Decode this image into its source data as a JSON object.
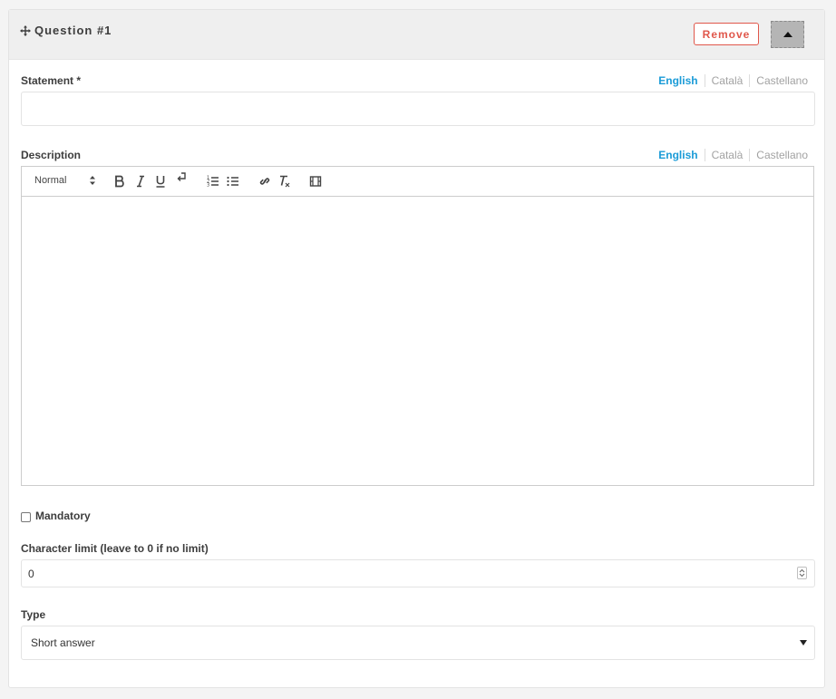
{
  "question": {
    "title": "Question #1",
    "remove_label": "Remove"
  },
  "statement": {
    "label": "Statement *",
    "value": "",
    "languages": [
      "English",
      "Català",
      "Castellano"
    ],
    "active_language": "English"
  },
  "description": {
    "label": "Description",
    "languages": [
      "English",
      "Català",
      "Castellano"
    ],
    "active_language": "English",
    "toolbar": {
      "format_select": "Normal",
      "buttons": [
        "bold-icon",
        "italic-icon",
        "underline-icon",
        "linebreak-icon",
        "ordered-list-icon",
        "bullet-list-icon",
        "link-icon",
        "clear-format-icon",
        "video-icon"
      ]
    },
    "value": ""
  },
  "mandatory": {
    "label": "Mandatory",
    "checked": false
  },
  "character_limit": {
    "label": "Character limit (leave to 0 if no limit)",
    "value": "0"
  },
  "type": {
    "label": "Type",
    "selected": "Short answer"
  },
  "colors": {
    "accent": "#1a9bd7",
    "danger": "#e0574b",
    "header_bg": "#efefef"
  }
}
